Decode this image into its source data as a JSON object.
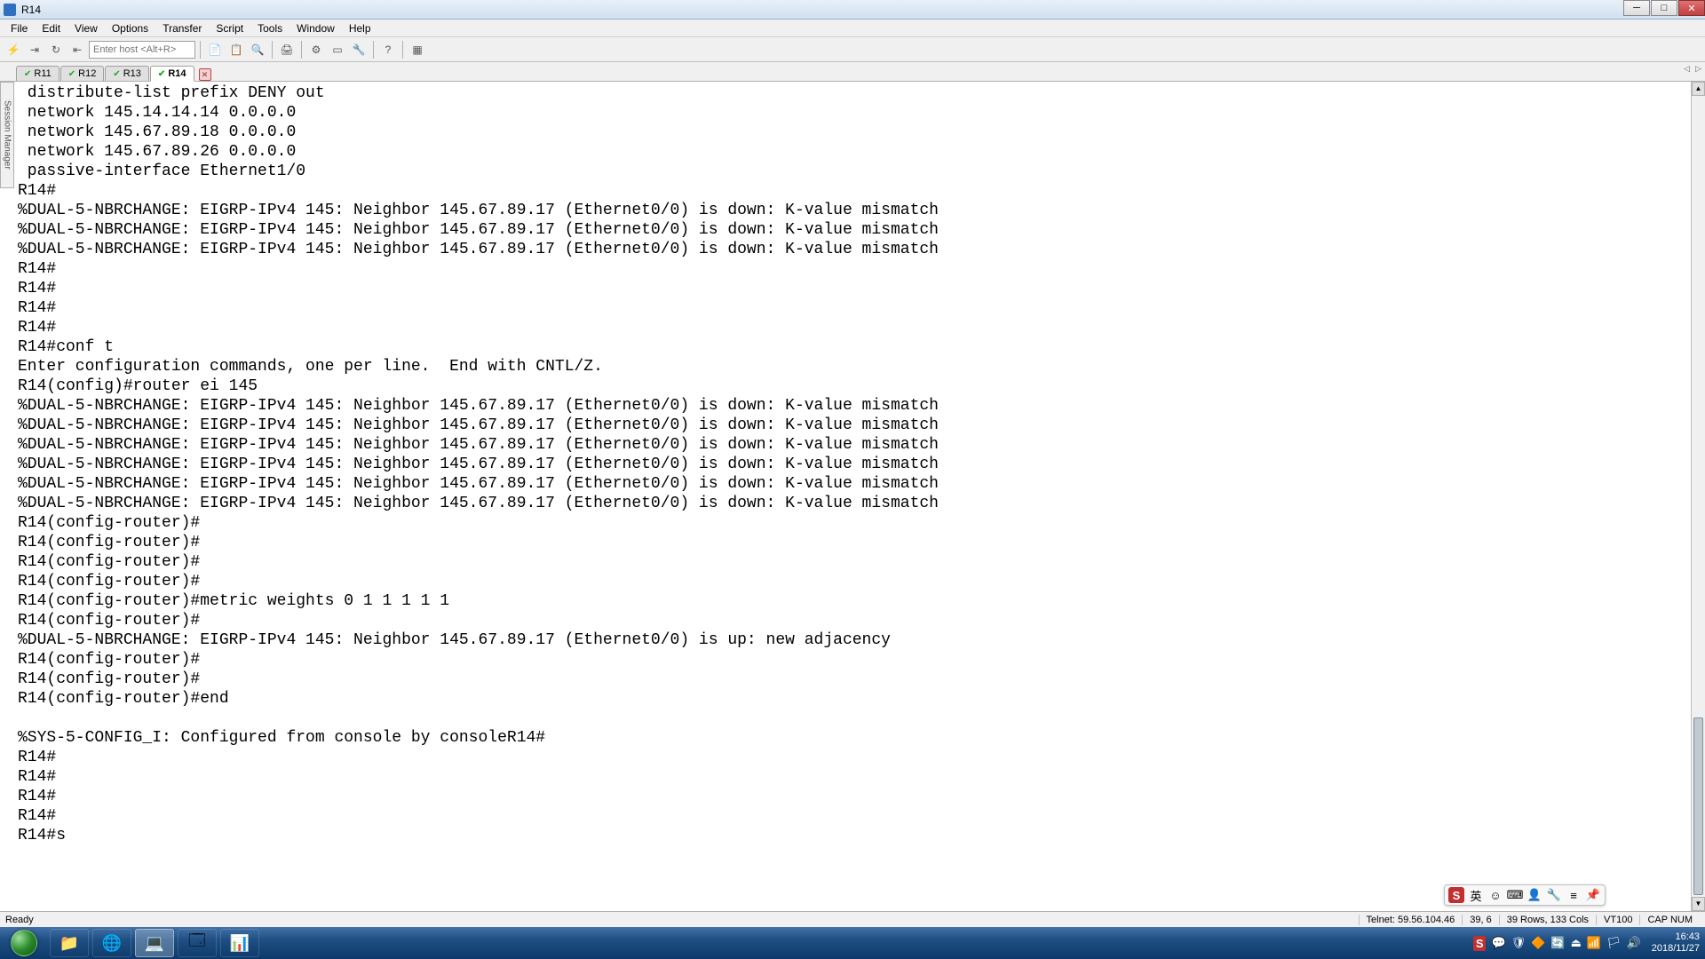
{
  "window": {
    "title": "R14"
  },
  "menu": [
    "File",
    "Edit",
    "View",
    "Options",
    "Transfer",
    "Script",
    "Tools",
    "Window",
    "Help"
  ],
  "toolbar": {
    "host_placeholder": "Enter host <Alt+R>"
  },
  "tabs": [
    {
      "label": "R11",
      "active": false
    },
    {
      "label": "R12",
      "active": false
    },
    {
      "label": "R13",
      "active": false
    },
    {
      "label": "R14",
      "active": true
    }
  ],
  "side_tab": "Session Manager",
  "terminal_lines": [
    " distribute-list prefix DENY out",
    " network 145.14.14.14 0.0.0.0",
    " network 145.67.89.18 0.0.0.0",
    " network 145.67.89.26 0.0.0.0",
    " passive-interface Ethernet1/0",
    "R14#",
    "%DUAL-5-NBRCHANGE: EIGRP-IPv4 145: Neighbor 145.67.89.17 (Ethernet0/0) is down: K-value mismatch",
    "%DUAL-5-NBRCHANGE: EIGRP-IPv4 145: Neighbor 145.67.89.17 (Ethernet0/0) is down: K-value mismatch",
    "%DUAL-5-NBRCHANGE: EIGRP-IPv4 145: Neighbor 145.67.89.17 (Ethernet0/0) is down: K-value mismatch",
    "R14#",
    "R14#",
    "R14#",
    "R14#",
    "R14#conf t",
    "Enter configuration commands, one per line.  End with CNTL/Z.",
    "R14(config)#router ei 145",
    "%DUAL-5-NBRCHANGE: EIGRP-IPv4 145: Neighbor 145.67.89.17 (Ethernet0/0) is down: K-value mismatch",
    "%DUAL-5-NBRCHANGE: EIGRP-IPv4 145: Neighbor 145.67.89.17 (Ethernet0/0) is down: K-value mismatch",
    "%DUAL-5-NBRCHANGE: EIGRP-IPv4 145: Neighbor 145.67.89.17 (Ethernet0/0) is down: K-value mismatch",
    "%DUAL-5-NBRCHANGE: EIGRP-IPv4 145: Neighbor 145.67.89.17 (Ethernet0/0) is down: K-value mismatch",
    "%DUAL-5-NBRCHANGE: EIGRP-IPv4 145: Neighbor 145.67.89.17 (Ethernet0/0) is down: K-value mismatch",
    "%DUAL-5-NBRCHANGE: EIGRP-IPv4 145: Neighbor 145.67.89.17 (Ethernet0/0) is down: K-value mismatch",
    "R14(config-router)#",
    "R14(config-router)#",
    "R14(config-router)#",
    "R14(config-router)#",
    "R14(config-router)#metric weights 0 1 1 1 1 1",
    "R14(config-router)#",
    "%DUAL-5-NBRCHANGE: EIGRP-IPv4 145: Neighbor 145.67.89.17 (Ethernet0/0) is up: new adjacency",
    "R14(config-router)#",
    "R14(config-router)#",
    "R14(config-router)#end",
    "",
    "%SYS-5-CONFIG_I: Configured from console by consoleR14#",
    "R14#",
    "R14#",
    "R14#",
    "R14#",
    "R14#s"
  ],
  "status": {
    "ready": "Ready",
    "telnet": "Telnet: 59.56.104.46",
    "cursor": "39,    6",
    "size": "39 Rows, 133 Cols",
    "term": "VT100",
    "caps": "CAP  NUM"
  },
  "ime": {
    "s": "S",
    "lang": "英"
  },
  "clock": {
    "time": "16:43",
    "date": "2018/11/27"
  }
}
